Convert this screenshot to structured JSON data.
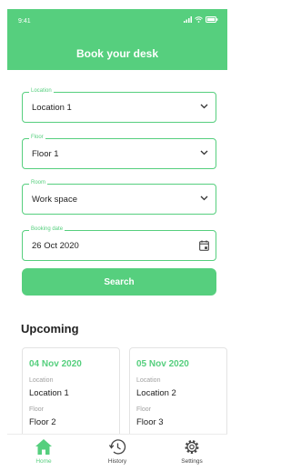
{
  "status_bar": {
    "time": "9:41"
  },
  "header": {
    "title": "Book your desk"
  },
  "form": {
    "location": {
      "label": "Location",
      "value": "Location 1"
    },
    "floor": {
      "label": "Floor",
      "value": "Floor 1"
    },
    "room": {
      "label": "Room",
      "value": "Work space"
    },
    "booking_date": {
      "label": "Booking date",
      "value": "26 Oct 2020"
    },
    "search_label": "Search"
  },
  "upcoming": {
    "title": "Upcoming",
    "cards": [
      {
        "date": "04 Nov 2020",
        "location_label": "Location",
        "location": "Location 1",
        "floor_label": "Floor",
        "floor": "Floor 2"
      },
      {
        "date": "05 Nov 2020",
        "location_label": "Location",
        "location": "Location 2",
        "floor_label": "Floor",
        "floor": "Floor 3"
      }
    ]
  },
  "bottom_nav": {
    "items": [
      {
        "label": "Home",
        "icon": "home-icon",
        "active": true
      },
      {
        "label": "History",
        "icon": "history-icon",
        "active": false
      },
      {
        "label": "Settings",
        "icon": "settings-icon",
        "active": false
      }
    ]
  },
  "colors": {
    "accent": "#56cf7e",
    "text": "#222222",
    "muted": "#a0a0a0"
  }
}
